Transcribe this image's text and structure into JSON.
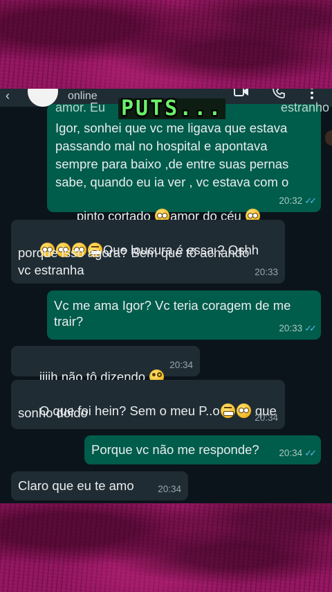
{
  "header": {
    "status": "online",
    "back_glyph": "‹",
    "icons": [
      "video-call-icon",
      "phone-icon",
      "more-options-icon"
    ]
  },
  "overlay": {
    "caption": "PUTS..."
  },
  "messages": [
    {
      "direction": "outgoing",
      "lines": [
        "amor. Eu",
        "Igor,  sonhei que vc me ligava que estava",
        "passando mal no hospital e apontava",
        "sempre para baixo ,de entre suas pernas",
        "sabe, quando eu ia ver , vc estava com o"
      ],
      "last_line_a": "pinto cortado ",
      "last_line_b": "amor do céu ",
      "trailing_partial": "estranho",
      "time": "20:32",
      "read": true
    },
    {
      "direction": "incoming",
      "line1_text": "Que loucura é essa ? Oshh",
      "line2": "porque isso agora? Bem que tô achando",
      "line3": "vc estranha",
      "time": "20:33"
    },
    {
      "direction": "outgoing",
      "text": "Vc me ama Igor? Vc teria coragem de me\ntrair?",
      "time": "20:33",
      "read": true
    },
    {
      "direction": "incoming",
      "text": "iiiih não tô dizendo ",
      "time": "20:34"
    },
    {
      "direction": "incoming",
      "text_a": "O que foi hein? Sem o meu P..o",
      "text_b": " que",
      "line2": "sonho doido",
      "time": "20:34"
    },
    {
      "direction": "outgoing",
      "text": "Porque vc não me responde?",
      "time": "20:34",
      "read": true
    },
    {
      "direction": "incoming",
      "text": "Claro que eu te amo",
      "time": "20:34"
    }
  ],
  "colors": {
    "outgoing_bubble": "#005c4b",
    "incoming_bubble": "#202c33",
    "chat_background": "#0b141a",
    "frame": "#92155f",
    "read_ticks": "#53bdeb",
    "overlay_text": "#6cf06a"
  },
  "read_ticks_glyph": "✓✓"
}
